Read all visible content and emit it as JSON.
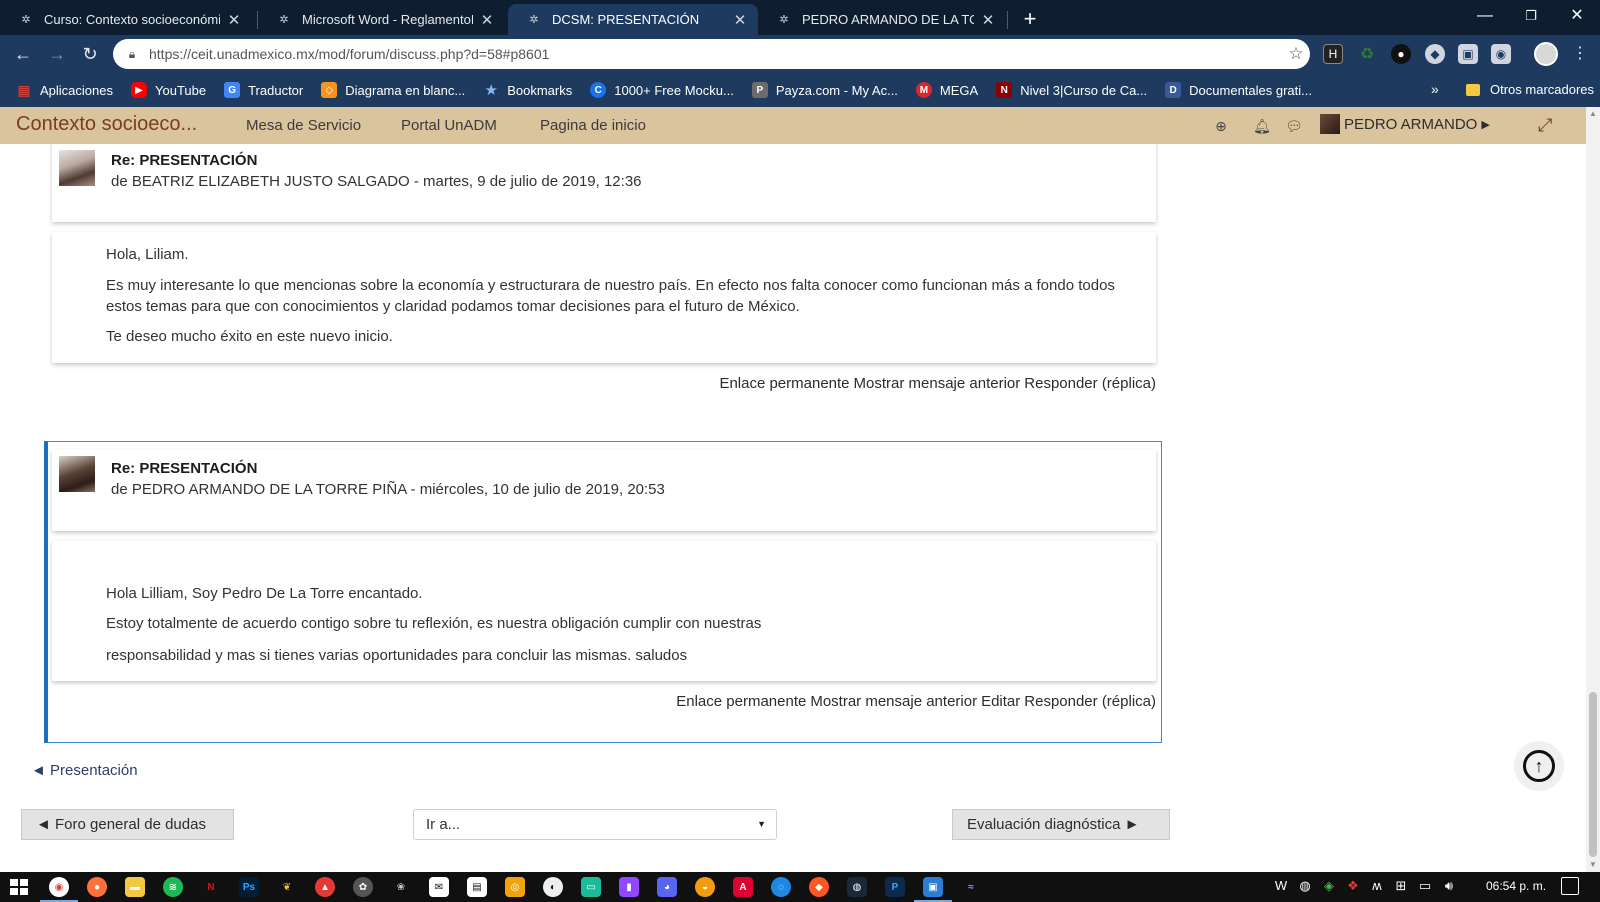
{
  "browser": {
    "tabs": [
      {
        "title": "Curso: Contexto socioeconómico",
        "active": false
      },
      {
        "title": "Microsoft Word - ReglamentoEsc",
        "active": false
      },
      {
        "title": "DCSM: PRESENTACIÓN",
        "active": true
      },
      {
        "title": "PEDRO ARMANDO DE LA TORRE",
        "active": false
      }
    ],
    "new_tab": "+",
    "url": "https://ceit.unadmexico.mx/mod/forum/discuss.php?d=58#p8601",
    "bookmarks": [
      {
        "label": "Aplicaciones",
        "color": "#e94235",
        "glyph": "▦"
      },
      {
        "label": "YouTube",
        "color": "#ff0000",
        "glyph": "▶"
      },
      {
        "label": "Traductor",
        "color": "#4285f4",
        "glyph": "G"
      },
      {
        "label": "Diagrama en blanc...",
        "color": "#f7941e",
        "glyph": "◇"
      },
      {
        "label": "Bookmarks",
        "color": "#8ab4f8",
        "glyph": "★"
      },
      {
        "label": "1000+ Free Mocku...",
        "color": "#1a73e8",
        "glyph": "C"
      },
      {
        "label": "Payza.com - My Ac...",
        "color": "#6c6c6c",
        "glyph": "P"
      },
      {
        "label": "MEGA",
        "color": "#d9272e",
        "glyph": "M"
      },
      {
        "label": "Nivel 3|Curso de Ca...",
        "color": "#8b0000",
        "glyph": "N"
      },
      {
        "label": "Documentales grati...",
        "color": "#3b5998",
        "glyph": "D"
      }
    ],
    "bookmarks_more": "»",
    "other_bookmarks": "Otros marcadores"
  },
  "moodle_nav": {
    "brand": "Contexto socioeco...",
    "links": [
      "Mesa de Servicio",
      "Portal UnADM",
      "Pagina de inicio"
    ],
    "user": "PEDRO ARMANDO"
  },
  "posts": [
    {
      "title": "Re: PRESENTACIÓN",
      "author_line": "de BEATRIZ ELIZABETH JUSTO SALGADO - martes, 9 de julio de 2019, 12:36",
      "paragraphs": [
        "Hola, Liliam.",
        "Es muy interesante lo que mencionas sobre la economía y estructurara de nuestro país. En efecto nos falta conocer como funcionan más a fondo todos estos temas para que con conocimientos y claridad podamos tomar decisiones para el futuro de México.",
        "Te deseo mucho éxito en este nuevo inicio."
      ],
      "commands": [
        "Enlace permanente",
        "Mostrar mensaje anterior",
        "Responder (réplica)"
      ]
    },
    {
      "title": "Re: PRESENTACIÓN",
      "author_line": "de PEDRO ARMANDO DE LA TORRE PIÑA - miércoles, 10 de julio de 2019, 20:53",
      "paragraphs": [
        "Hola Lilliam, Soy Pedro De La Torre encantado.",
        "Estoy totalmente de acuerdo contigo sobre tu reflexión, es nuestra obligación cumplir con nuestras",
        "responsabilidad y mas si tienes varias oportunidades para concluir las mismas. saludos"
      ],
      "commands": [
        "Enlace permanente",
        "Mostrar mensaje anterior",
        "Editar",
        "Responder (réplica)"
      ]
    }
  ],
  "prev_discussion": "◄ Presentación",
  "activity_nav": {
    "prev": "◄ Foro general de dudas",
    "jump": "Ir a...",
    "next": "Evaluación diagnóstica ►"
  },
  "taskbar": {
    "clock": "06:54 p. m."
  },
  "colors": {
    "chrome_dark": "#0f1d30",
    "chrome": "#1e3a5f",
    "moodle_bar": "#d9c49e",
    "brand": "#7a3e1e",
    "highlight_border": "#1b6fbf"
  }
}
